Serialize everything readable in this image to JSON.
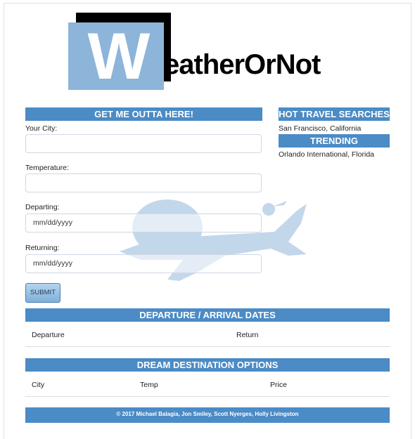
{
  "logo": {
    "big_letter": "W",
    "wordmark": "eatherOrNot"
  },
  "form": {
    "heading": "GET ME OUTTA HERE!",
    "city_label": "Your City:",
    "temp_label": "Temperature:",
    "depart_label": "Departing:",
    "depart_placeholder": "mm/dd/yyyy",
    "return_label": "Returning:",
    "return_placeholder": "mm/dd/yyyy",
    "submit_label": "SUBMIT"
  },
  "sidebar": {
    "hot_heading": "HOT TRAVEL SEARCHES",
    "hot_item": "San Francisco, California",
    "trending_heading": "TRENDING DESTINATIONS",
    "trending_item": "Orlando International, Florida"
  },
  "dates_table": {
    "heading": "DEPARTURE / ARRIVAL DATES",
    "columns": [
      "Departure",
      "Return"
    ]
  },
  "dream_table": {
    "heading": "DREAM DESTINATION OPTIONS",
    "columns": [
      "City",
      "Temp",
      "Price"
    ]
  },
  "footer": {
    "text": "© 2017 Michael Balagia, Jon Smiley, Scott Nyerges, Holly Livingston"
  },
  "colors": {
    "accent": "#4b8bc6",
    "logo_blue": "#8db4d9",
    "watermark": "#b9d1e8"
  }
}
